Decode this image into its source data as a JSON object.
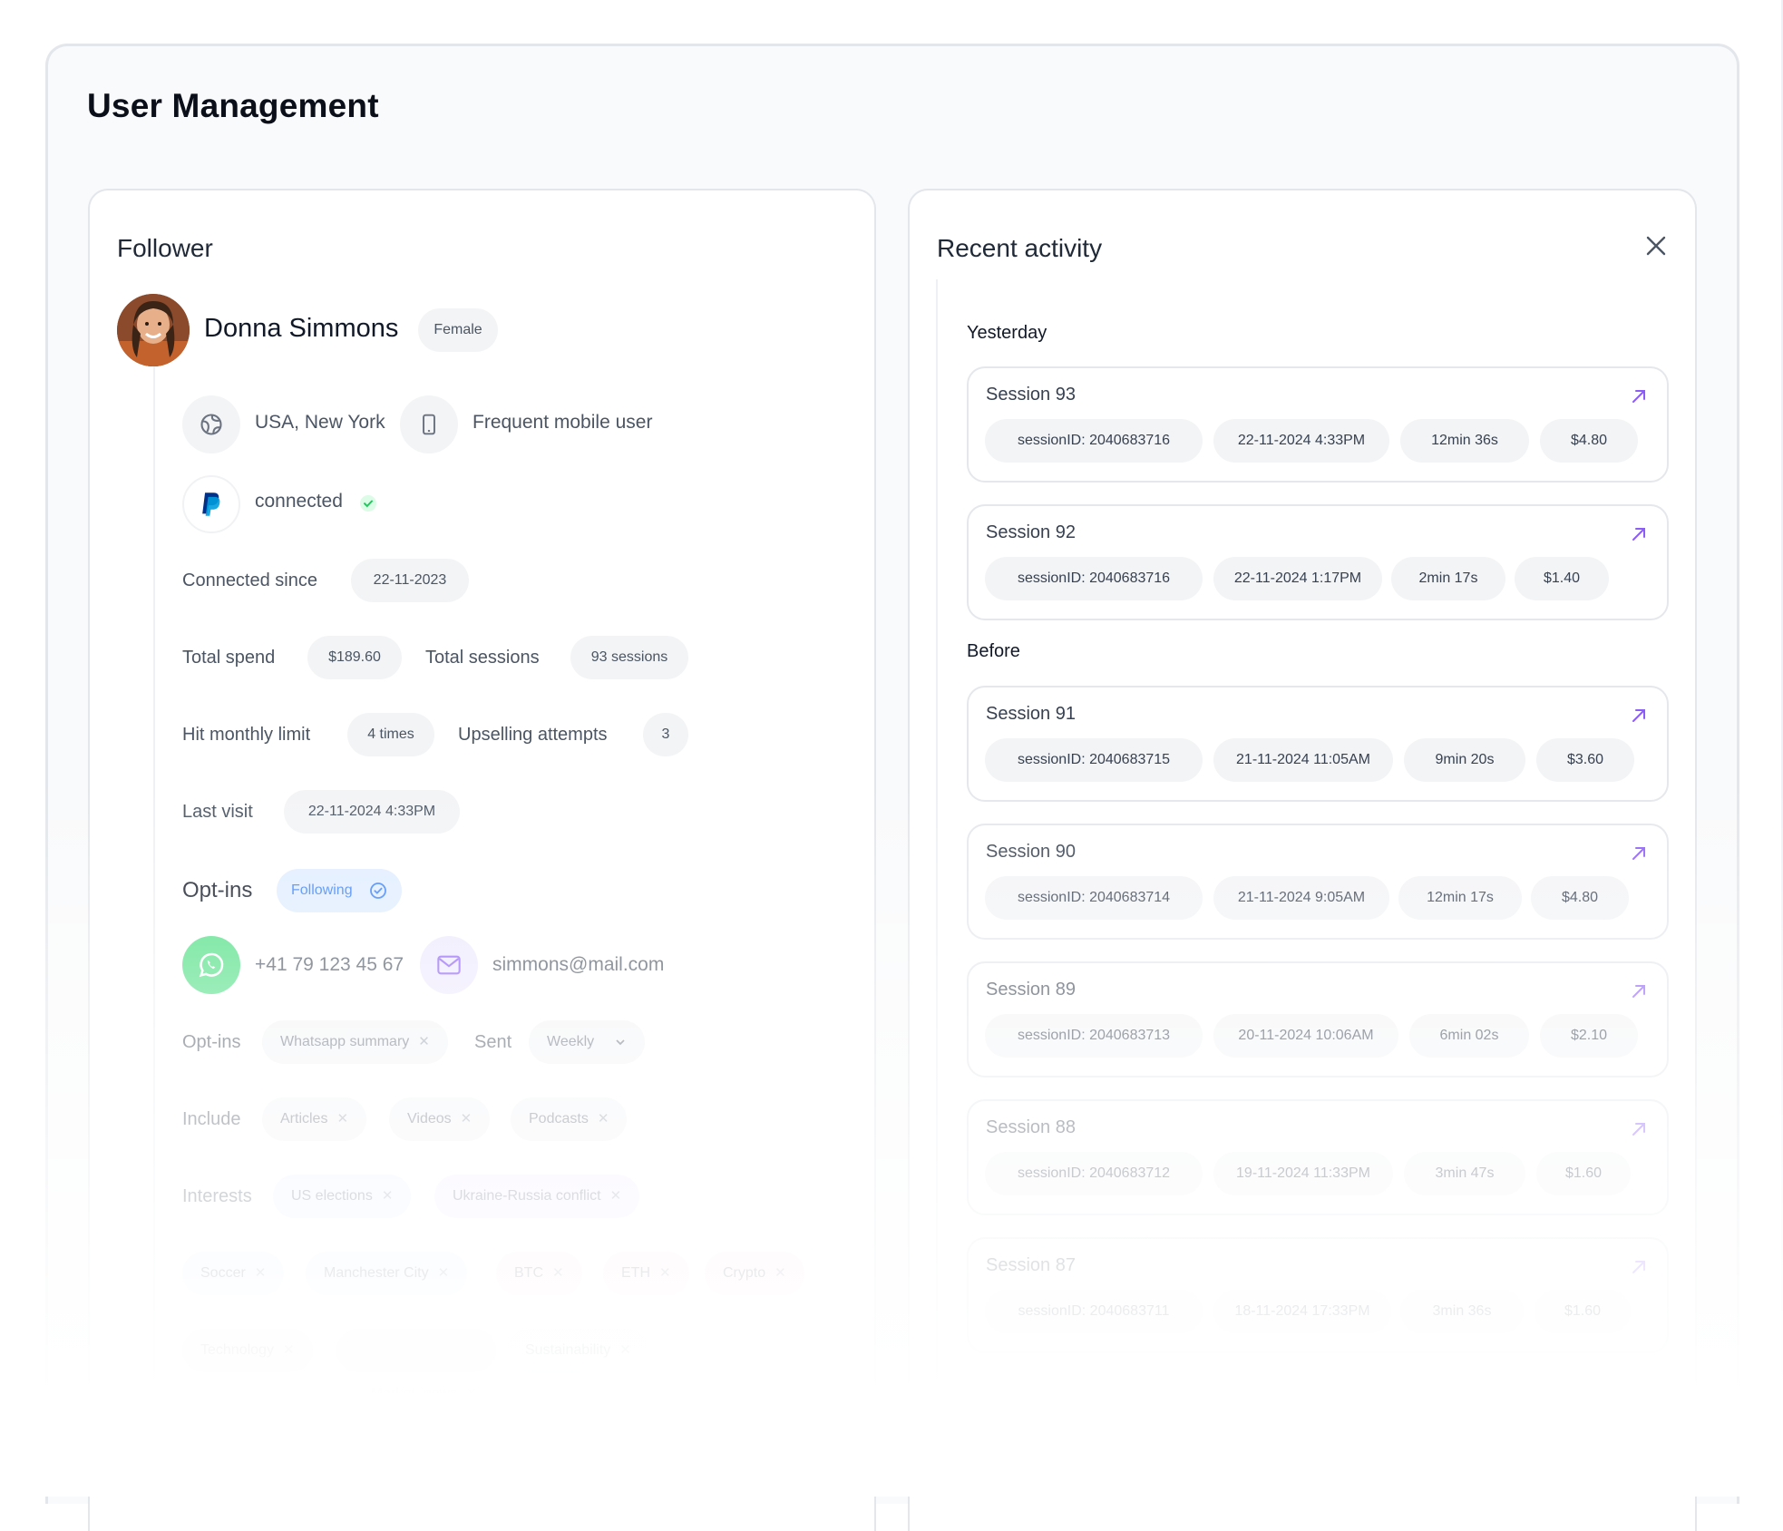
{
  "page": {
    "title": "User Management"
  },
  "follower": {
    "title": "Follower",
    "name": "Donna Simmons",
    "gender": "Female",
    "location": "USA, New York",
    "device": "Frequent mobile user",
    "paypal_status": "connected",
    "connected_since_label": "Connected since",
    "connected_since_value": "22-11-2023",
    "total_spend_label": "Total spend",
    "total_spend_value": "$189.60",
    "total_sessions_label": "Total sessions",
    "total_sessions_value": "93 sessions",
    "hit_limit_label": "Hit monthly limit",
    "hit_limit_value": "4 times",
    "upselling_label": "Upselling attempts",
    "upselling_value": "3",
    "last_visit_label": "Last visit",
    "last_visit_value": "22-11-2024 4:33PM",
    "optins_title": "Opt-ins",
    "following_label": "Following",
    "phone": "+41 79 123 45 67",
    "email": "simmons@mail.com",
    "optins_label": "Opt-ins",
    "optin_tag": "Whatsapp summary",
    "sent_label": "Sent",
    "sent_value": "Weekly",
    "include_label": "Include",
    "include_tags": [
      "Articles",
      "Videos",
      "Podcasts"
    ],
    "interests_label": "Interests",
    "interest_tags": [
      "US elections",
      "Ukraine-Russia conflict",
      "Soccer",
      "Manchester City",
      "BTC",
      "ETH",
      "Crypto",
      "Technology",
      "Market  news",
      "Sustainability"
    ],
    "tag_remove_glyph": "✕"
  },
  "activity": {
    "title": "Recent activity",
    "close_glyph": "✕",
    "group_yesterday": "Yesterday",
    "group_before": "Before",
    "sessions": [
      {
        "title": "Session 93",
        "id": "sessionID: 2040683716",
        "datetime": "22-11-2024 4:33PM",
        "duration": "12min 36s",
        "amount": "$4.80"
      },
      {
        "title": "Session 92",
        "id": "sessionID: 2040683716",
        "datetime": "22-11-2024 1:17PM",
        "duration": "2min 17s",
        "amount": "$1.40"
      },
      {
        "title": "Session 91",
        "id": "sessionID: 2040683715",
        "datetime": "21-11-2024 11:05AM",
        "duration": "9min 20s",
        "amount": "$3.60"
      },
      {
        "title": "Session 90",
        "id": "sessionID: 2040683714",
        "datetime": "21-11-2024 9:05AM",
        "duration": "12min 17s",
        "amount": "$4.80"
      },
      {
        "title": "Session 89",
        "id": "sessionID: 2040683713",
        "datetime": "20-11-2024 10:06AM",
        "duration": "6min 02s",
        "amount": "$2.10"
      },
      {
        "title": "Session 88",
        "id": "sessionID: 2040683712",
        "datetime": "19-11-2024 11:33PM",
        "duration": "3min 47s",
        "amount": "$1.60"
      },
      {
        "title": "Session 87",
        "id": "sessionID: 2040683711",
        "datetime": "18-11-2024 17:33PM",
        "duration": "3min 36s",
        "amount": "$1.60"
      }
    ]
  },
  "colors": {
    "accent_purple": "#8b5cf6",
    "following_blue": "#3b82f6",
    "whatsapp_green": "#4ade80",
    "paypal_dark": "#003087",
    "paypal_light": "#009cde",
    "check_green": "#22c55e"
  },
  "icons": {
    "globe": "globe-icon",
    "phone": "smartphone-icon",
    "paypal": "paypal-icon",
    "check": "check-icon",
    "whatsapp": "whatsapp-icon",
    "mail": "mail-icon",
    "arrow": "arrow-up-right-icon",
    "chevron": "chevron-down-icon",
    "close": "close-icon"
  }
}
